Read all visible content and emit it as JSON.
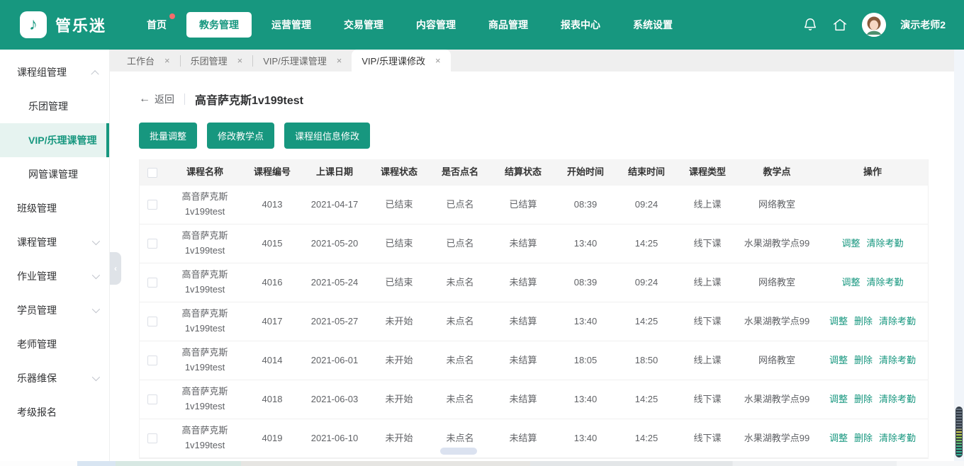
{
  "brand": {
    "name": "管乐迷",
    "logo_icon": "music-note-icon"
  },
  "colors": {
    "primary": "#17977F",
    "badge_red": "#f56c6c",
    "link_teal": "#17977F",
    "sidebar_active_bg": "#e6f3f0"
  },
  "nav": {
    "items": [
      {
        "label": "首页",
        "badge": true,
        "active": false
      },
      {
        "label": "教务管理",
        "badge": false,
        "active": true
      },
      {
        "label": "运营管理",
        "badge": false,
        "active": false
      },
      {
        "label": "交易管理",
        "badge": false,
        "active": false
      },
      {
        "label": "内容管理",
        "badge": false,
        "active": false
      },
      {
        "label": "商品管理",
        "badge": false,
        "active": false
      },
      {
        "label": "报表中心",
        "badge": false,
        "active": false
      },
      {
        "label": "系统设置",
        "badge": false,
        "active": false
      }
    ],
    "icons": [
      "bell-icon",
      "home-icon"
    ]
  },
  "user": {
    "name": "演示老师2"
  },
  "sidebar": {
    "items": [
      {
        "label": "课程组管理",
        "chevron": "up",
        "children": [
          {
            "label": "乐团管理",
            "active": false
          },
          {
            "label": "VIP/乐理课管理",
            "active": true
          },
          {
            "label": "网管课管理",
            "active": false
          }
        ]
      },
      {
        "label": "班级管理",
        "chevron": ""
      },
      {
        "label": "课程管理",
        "chevron": "down"
      },
      {
        "label": "作业管理",
        "chevron": "down"
      },
      {
        "label": "学员管理",
        "chevron": "down"
      },
      {
        "label": "老师管理",
        "chevron": ""
      },
      {
        "label": "乐器维保",
        "chevron": "down"
      },
      {
        "label": "考级报名",
        "chevron": ""
      }
    ]
  },
  "tabs": [
    {
      "label": "工作台",
      "active": false
    },
    {
      "label": "乐团管理",
      "active": false
    },
    {
      "label": "VIP/乐理课管理",
      "active": false
    },
    {
      "label": "VIP/乐理课修改",
      "active": true
    }
  ],
  "page": {
    "back_label": "返回",
    "title": "高音萨克斯1v199test",
    "buttons": [
      "批量调整",
      "修改教学点",
      "课程组信息修改"
    ]
  },
  "table": {
    "columns": [
      "课程名称",
      "课程编号",
      "上课日期",
      "课程状态",
      "是否点名",
      "结算状态",
      "开始时间",
      "结束时间",
      "课程类型",
      "教学点",
      "操作"
    ],
    "rows": [
      {
        "name": "高音萨克斯1v199test",
        "code": "4013",
        "date": "2021-04-17",
        "status": "已结束",
        "rollcall": "已点名",
        "settlement": "已结算",
        "start": "08:39",
        "end": "09:24",
        "type": "线上课",
        "venue": "网络教室",
        "actions": []
      },
      {
        "name": "高音萨克斯1v199test",
        "code": "4015",
        "date": "2021-05-20",
        "status": "已结束",
        "rollcall": "已点名",
        "settlement": "未结算",
        "start": "13:40",
        "end": "14:25",
        "type": "线下课",
        "venue": "水果湖教学点99",
        "actions": [
          "调整",
          "清除考勤"
        ]
      },
      {
        "name": "高音萨克斯1v199test",
        "code": "4016",
        "date": "2021-05-24",
        "status": "已结束",
        "rollcall": "未点名",
        "settlement": "未结算",
        "start": "08:39",
        "end": "09:24",
        "type": "线上课",
        "venue": "网络教室",
        "actions": [
          "调整",
          "清除考勤"
        ]
      },
      {
        "name": "高音萨克斯1v199test",
        "code": "4017",
        "date": "2021-05-27",
        "status": "未开始",
        "rollcall": "未点名",
        "settlement": "未结算",
        "start": "13:40",
        "end": "14:25",
        "type": "线下课",
        "venue": "水果湖教学点99",
        "actions": [
          "调整",
          "删除",
          "清除考勤"
        ]
      },
      {
        "name": "高音萨克斯1v199test",
        "code": "4014",
        "date": "2021-06-01",
        "status": "未开始",
        "rollcall": "未点名",
        "settlement": "未结算",
        "start": "18:05",
        "end": "18:50",
        "type": "线上课",
        "venue": "网络教室",
        "actions": [
          "调整",
          "删除",
          "清除考勤"
        ]
      },
      {
        "name": "高音萨克斯1v199test",
        "code": "4018",
        "date": "2021-06-03",
        "status": "未开始",
        "rollcall": "未点名",
        "settlement": "未结算",
        "start": "13:40",
        "end": "14:25",
        "type": "线下课",
        "venue": "水果湖教学点99",
        "actions": [
          "调整",
          "删除",
          "清除考勤"
        ]
      },
      {
        "name": "高音萨克斯1v199test",
        "code": "4019",
        "date": "2021-06-10",
        "status": "未开始",
        "rollcall": "未点名",
        "settlement": "未结算",
        "start": "13:40",
        "end": "14:25",
        "type": "线下课",
        "venue": "水果湖教学点99",
        "actions": [
          "调整",
          "删除",
          "清除考勤"
        ]
      }
    ]
  }
}
